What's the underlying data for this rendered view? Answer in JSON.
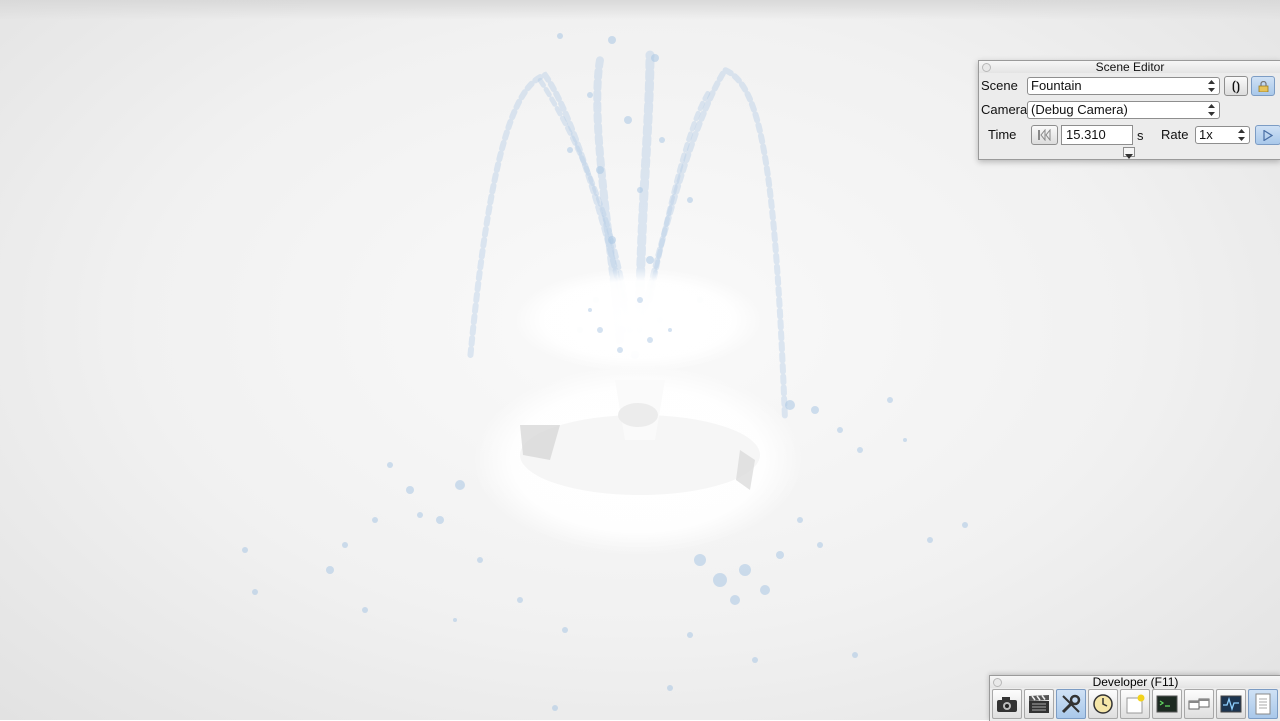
{
  "scene_editor": {
    "title": "Scene Editor",
    "scene_label": "Scene",
    "scene_value": "Fountain",
    "camera_label": "Camera",
    "camera_value": "(Debug Camera)",
    "time_label": "Time",
    "time_value": "15.310",
    "time_unit": "s",
    "rate_label": "Rate",
    "rate_value": "1x",
    "refresh_glyph": "⟮⟯"
  },
  "developer_toolbar": {
    "title": "Developer (F11)",
    "buttons": [
      {
        "icon": "camera-icon"
      },
      {
        "icon": "clapperboard-icon"
      },
      {
        "icon": "tools-icon",
        "active": true
      },
      {
        "icon": "clock-icon"
      },
      {
        "icon": "new-note-icon"
      },
      {
        "icon": "terminal-icon"
      },
      {
        "icon": "windows-icon"
      },
      {
        "icon": "waveform-icon"
      },
      {
        "icon": "document-icon"
      }
    ]
  },
  "colors": {
    "background": "#f1f1f1",
    "water": "#a9c6e3",
    "panel": "#ececec",
    "accent": "#a9c8ea"
  }
}
